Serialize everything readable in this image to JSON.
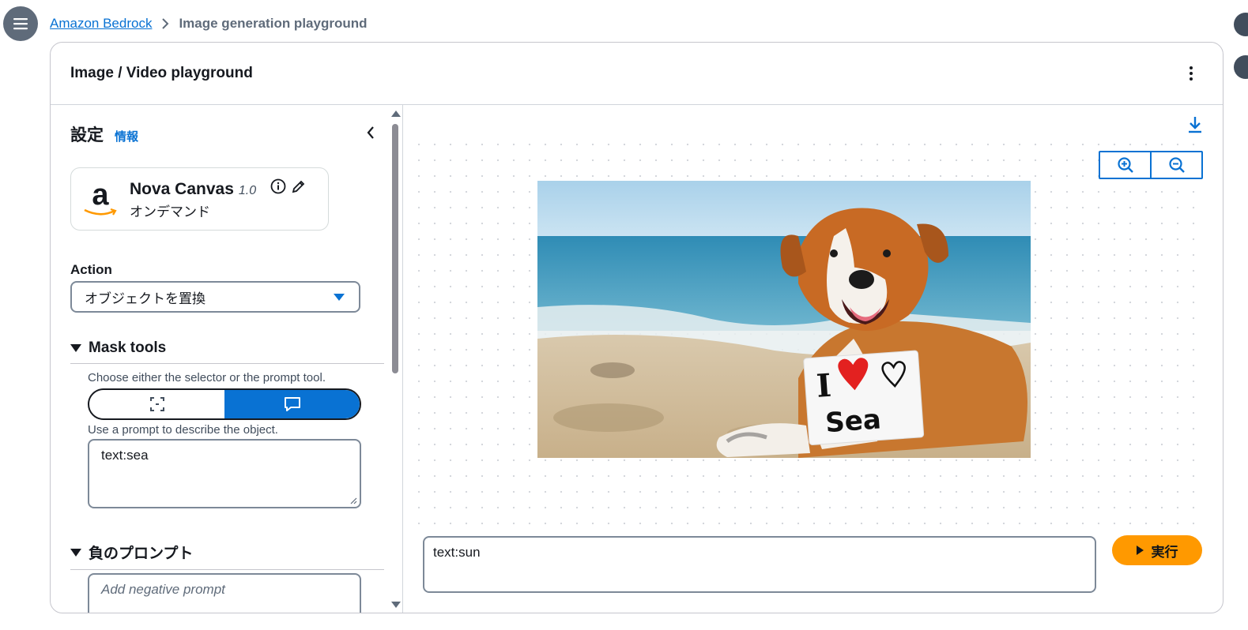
{
  "breadcrumb": {
    "root": "Amazon Bedrock",
    "current": "Image generation playground"
  },
  "container": {
    "title": "Image / Video playground"
  },
  "settings": {
    "title": "設定",
    "info_link": "情報",
    "model": {
      "name": "Nova Canvas",
      "version": "1.0",
      "mode": "オンデマンド"
    },
    "action_label": "Action",
    "action_value": "オブジェクトを置換",
    "mask_tools": {
      "title": "Mask tools",
      "help": "Choose either the selector or the prompt tool.",
      "selected_tool": "prompt",
      "prompt_help": "Use a prompt to describe the object.",
      "mask_prompt": "text:sea"
    },
    "negative_prompt": {
      "title": "負のプロンプト",
      "placeholder": "Add negative prompt"
    }
  },
  "canvas": {
    "image": {
      "description_icon": "dog-holding-sign-image",
      "sign_text_1": "I",
      "sign_text_2": "Sea"
    }
  },
  "prompt": {
    "value": "text:sun"
  },
  "run_button": {
    "label": "実行"
  },
  "colors": {
    "accent": "#0972d3",
    "run": "#ff9900",
    "text": "#16191f"
  }
}
